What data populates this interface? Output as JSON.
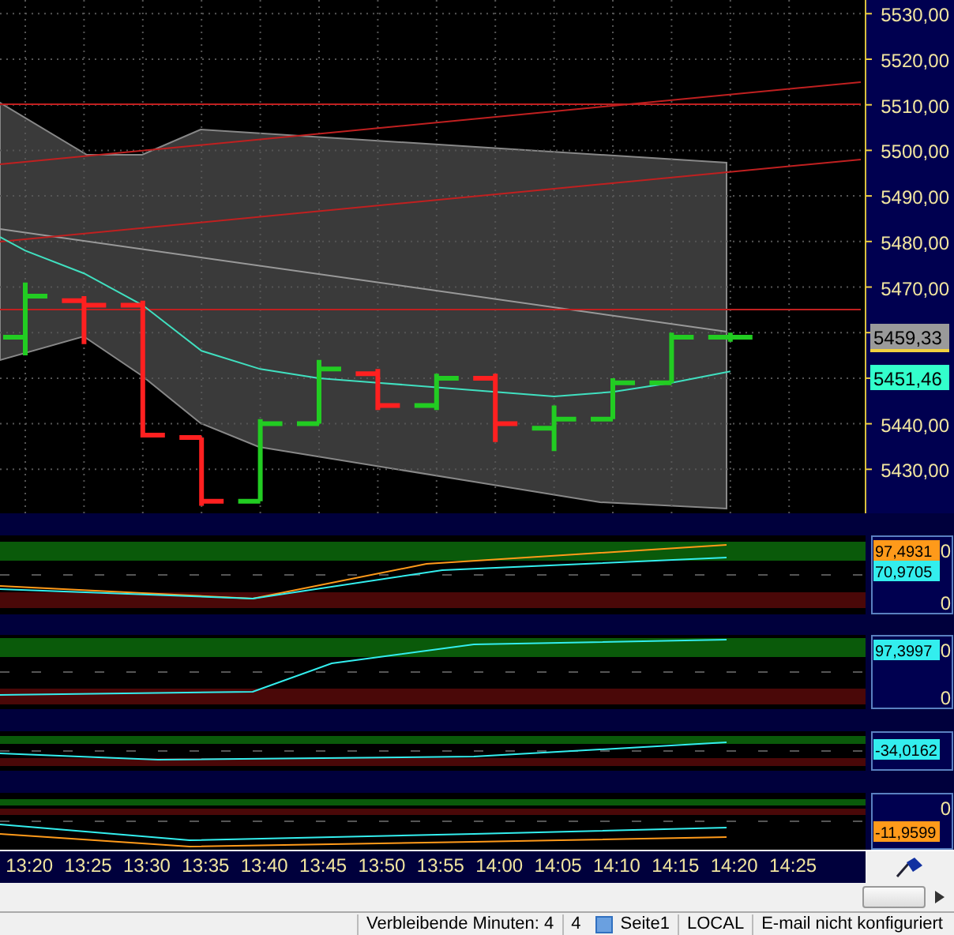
{
  "main_chart": {
    "price_axis": [
      "5530,00",
      "5520,00",
      "5510,00",
      "5500,00",
      "5490,00",
      "5480,00",
      "5470,00",
      "5440,00",
      "5430,00"
    ],
    "price_labels": [
      {
        "text": "5459,33",
        "color": "#9a9a9a"
      },
      {
        "text": "5451,46",
        "color": "#33ffcc"
      }
    ]
  },
  "indicators": [
    {
      "values": [
        {
          "text": "97,4931",
          "color": "#ff9a1a"
        },
        {
          "text": "70,9705",
          "color": "#33eeee"
        }
      ],
      "axis_labels": [
        "0",
        "0"
      ]
    },
    {
      "values": [
        {
          "text": "97,3997",
          "color": "#33eeee"
        }
      ],
      "axis_labels": [
        "0",
        "0"
      ]
    },
    {
      "values": [
        {
          "text": "-34,0162",
          "color": "#33eeee"
        }
      ]
    },
    {
      "values": [
        {
          "text": "-11,9599",
          "color": "#ff9a1a"
        }
      ],
      "axis_labels": [
        "0"
      ]
    }
  ],
  "time_axis": [
    "13:20",
    "13:25",
    "13:30",
    "13:35",
    "13:40",
    "13:45",
    "13:50",
    "13:55",
    "14:00",
    "14:05",
    "14:10",
    "14:15",
    "14:20",
    "14:25"
  ],
  "status_bar": {
    "remaining": "Verbleibende Minuten: 4",
    "count": "4",
    "page": "Seite1",
    "mode": "LOCAL",
    "email": "E-mail nicht konfiguriert"
  }
}
